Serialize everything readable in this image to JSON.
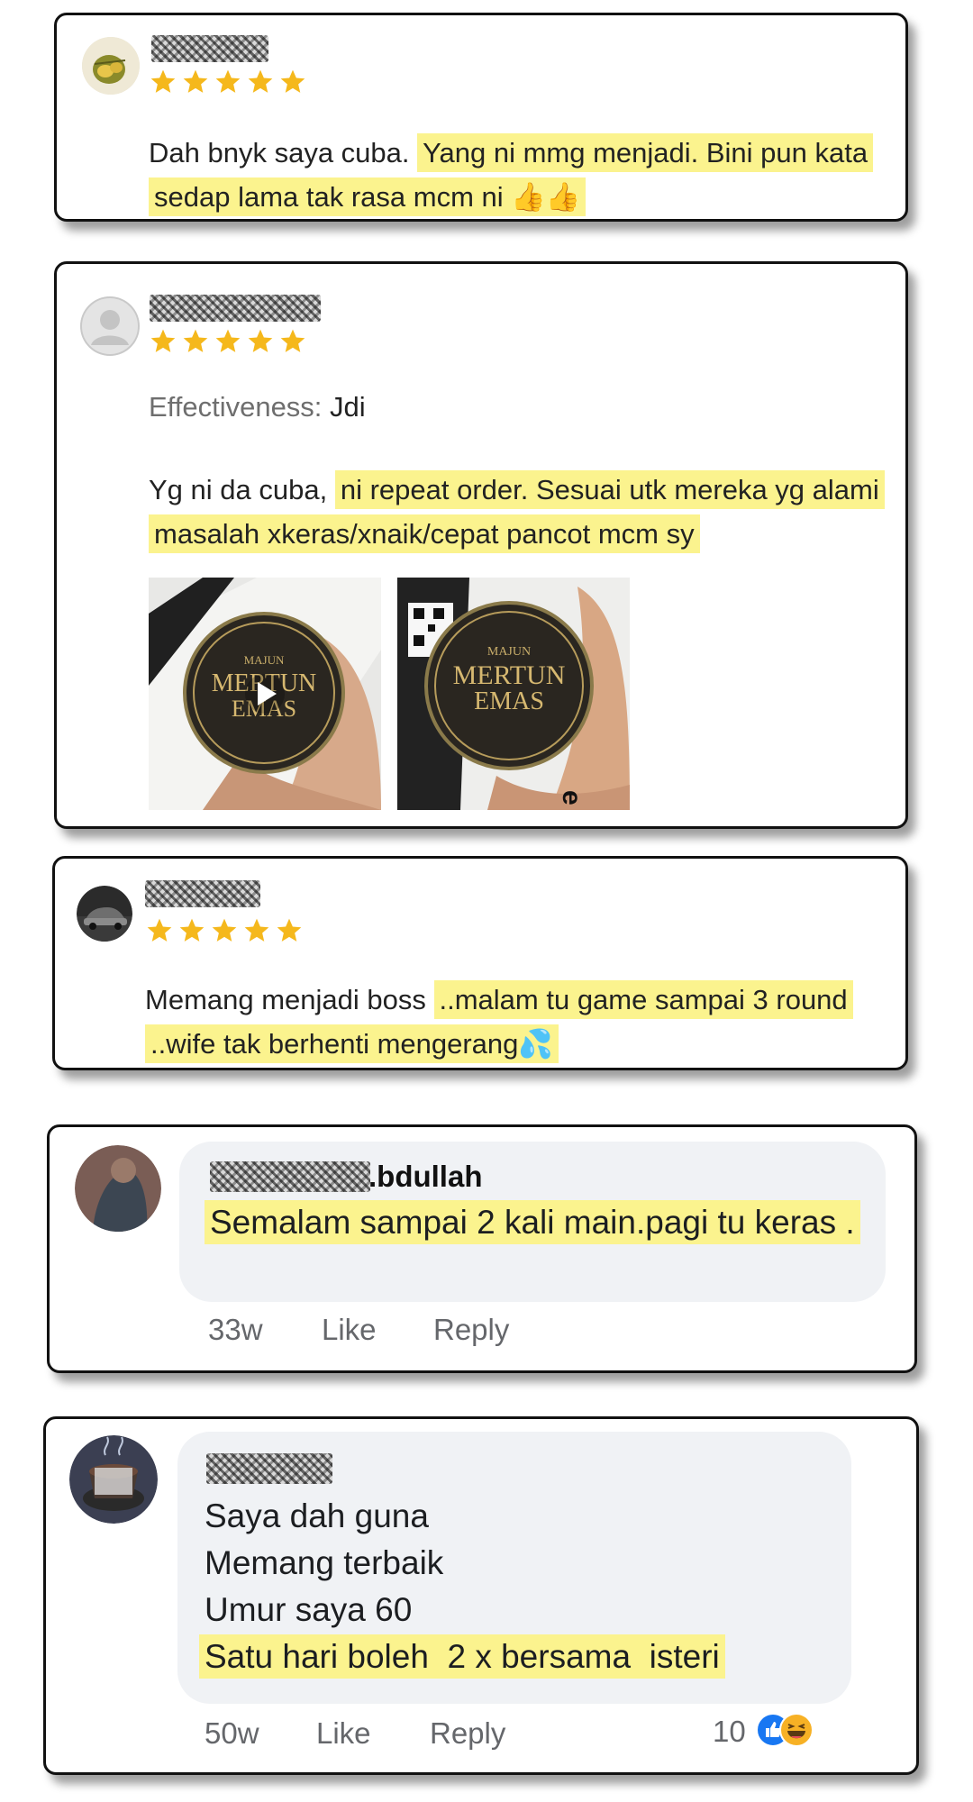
{
  "reviews": [
    {
      "stars": 5,
      "text_plain": "Dah bnyk saya cuba. ",
      "text_highlight": "Yang ni mmg menjadi. Bini pun kata sedap lama tak rasa mcm ni 👍👍"
    },
    {
      "stars": 5,
      "effectiveness_label": "Effectiveness:",
      "effectiveness_value": "Jdi",
      "text_plain": "Yg ni da cuba, ",
      "text_highlight": "ni repeat order. Sesuai utk mereka yg alami masalah xkeras/xnaik/cepat pancot mcm sy",
      "product": {
        "brand_small": "MAJUN",
        "brand_line1": "MERTUN",
        "brand_line2": "EMAS",
        "back_letter": "e"
      }
    },
    {
      "stars": 5,
      "text_plain": "Memang menjadi boss ",
      "text_highlight": "..malam tu game sampai 3 round ..wife tak berhenti mengerang💦"
    }
  ],
  "comments": [
    {
      "name_suffix": ".bdullah",
      "text": "Semalam sampai 2 kali main.pagi tu keras .",
      "time": "33w",
      "like": "Like",
      "reply": "Reply"
    },
    {
      "lines": [
        "Saya dah guna",
        "Memang terbaik",
        "Umur saya 60"
      ],
      "highlight_line": "Satu hari boleh  2 x bersama  isteri",
      "time": "50w",
      "like": "Like",
      "reply": "Reply",
      "reaction_count": "10"
    }
  ],
  "colors": {
    "star": "#f5b81c",
    "highlight": "#fbf38e",
    "fb_blue": "#1877f2",
    "haha": "#f7b125"
  }
}
